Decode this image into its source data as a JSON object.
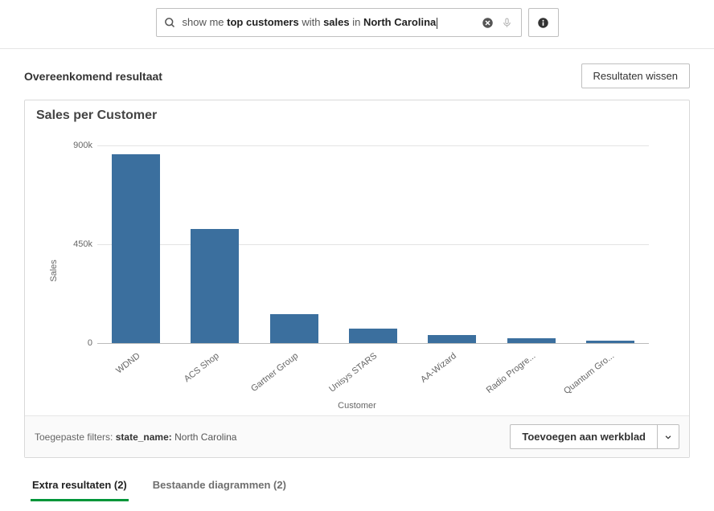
{
  "search": {
    "prefix": "show me ",
    "b1": "top customers",
    "mid1": " with ",
    "b2": "sales",
    "mid2": " in ",
    "b3": "North Carolina"
  },
  "section": {
    "matching_result": "Overeenkomend resultaat",
    "clear_results": "Resultaten wissen"
  },
  "chart_data": {
    "type": "bar",
    "title": "Sales per Customer",
    "ylabel": "Sales",
    "xlabel": "Customer",
    "ylim": [
      0,
      900000
    ],
    "yticks": [
      {
        "value": 0,
        "label": "0"
      },
      {
        "value": 450000,
        "label": "450k"
      },
      {
        "value": 900000,
        "label": "900k"
      }
    ],
    "categories": [
      "WDND",
      "ACS Shop",
      "Gartner Group",
      "Unisys STARS",
      "AA-Wizard",
      "Radio Progre...",
      "Quantum Gro..."
    ],
    "values": [
      860000,
      520000,
      130000,
      65000,
      35000,
      22000,
      10000
    ]
  },
  "footer": {
    "filters_label": "Toegepaste filters:",
    "filter_key": "state_name:",
    "filter_value": "North Carolina",
    "add_to_sheet": "Toevoegen aan werkblad"
  },
  "tabs": {
    "extra": "Extra resultaten (2)",
    "existing": "Bestaande diagrammen (2)"
  }
}
